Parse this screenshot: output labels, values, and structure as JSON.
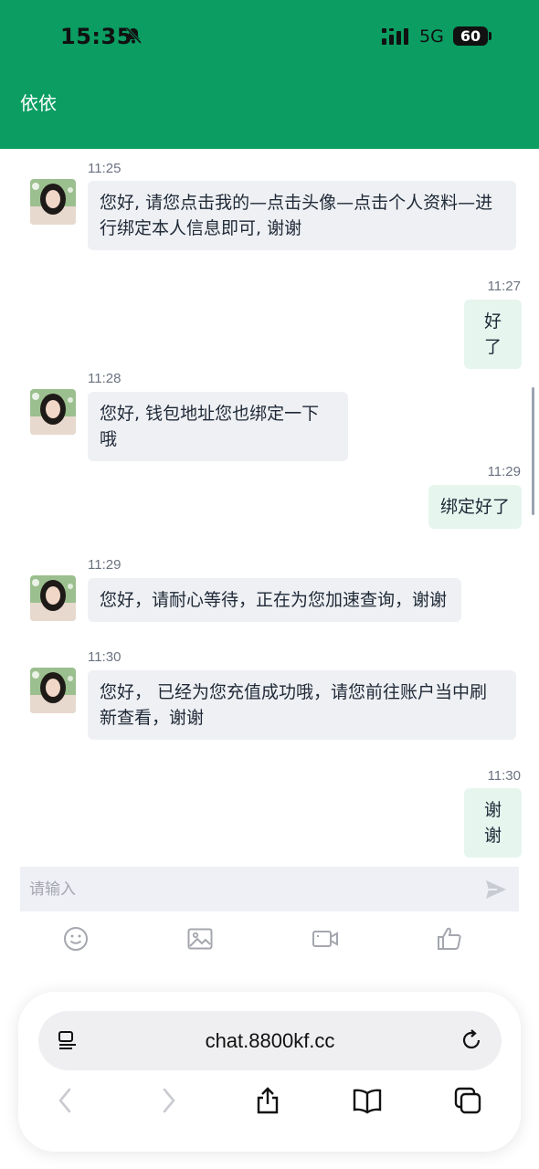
{
  "status_bar": {
    "time": "15:35",
    "network": "5G",
    "battery": "60"
  },
  "header": {
    "title": "依依"
  },
  "messages": [
    {
      "side": "in",
      "time": "11:25",
      "text_lines": [
        "您好, 请您点击我的—点击头像—点击个人资料—进",
        "行绑定本人信息即可, 谢谢"
      ]
    },
    {
      "side": "out",
      "time": "11:27",
      "text": "好了"
    },
    {
      "side": "in",
      "time": "11:28",
      "text": "您好, 钱包地址您也绑定一下哦"
    },
    {
      "side": "out",
      "time": "11:29",
      "text": "绑定好了"
    },
    {
      "side": "in",
      "time": "11:29",
      "text": "您好，请耐心等待，正在为您加速查询，谢谢"
    },
    {
      "side": "in",
      "time": "11:30",
      "text_lines": [
        "您好， 已经为您充值成功哦，请您前往账户当中刷",
        "新查看，谢谢"
      ]
    },
    {
      "side": "out",
      "time": "11:30",
      "text": "谢谢"
    }
  ],
  "composer": {
    "placeholder": "请输入"
  },
  "toolbar_icons": [
    "emoji-icon",
    "image-icon",
    "video-icon",
    "thumbs-up-icon"
  ],
  "browser": {
    "url": "chat.8800kf.cc"
  },
  "colors": {
    "header_green": "#0b9d62",
    "incoming_bubble": "#eef0f3",
    "outgoing_bubble": "#e6f6ee"
  }
}
